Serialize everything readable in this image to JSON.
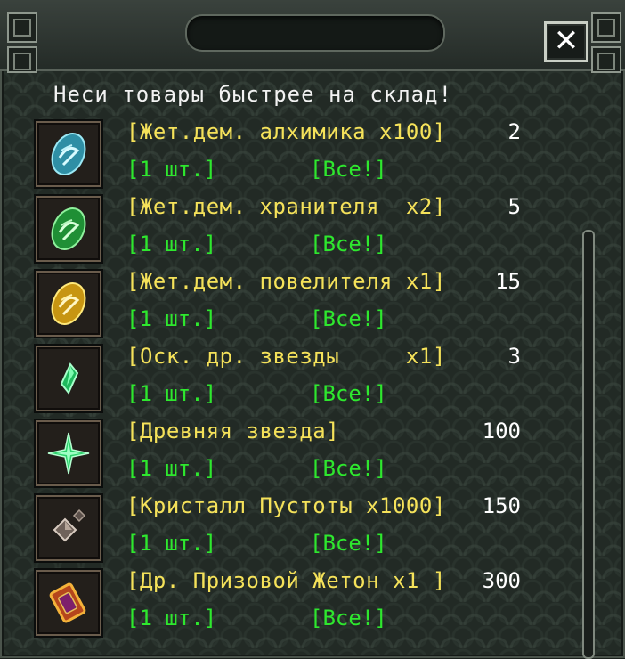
{
  "window": {
    "close_label": "✕",
    "headline": "Неси товары быстрее на склад!"
  },
  "items": [
    {
      "name": "[Жет.дем. алхимика x100]",
      "price": "2",
      "one": "[1 шт.]",
      "all": "[Все!]",
      "icon": "blue-demon-token-icon",
      "color": "#4cc6d8"
    },
    {
      "name": "[Жет.дем. хранителя  x2]",
      "price": "5",
      "one": "[1 шт.]",
      "all": "[Все!]",
      "icon": "green-demon-token-icon",
      "color": "#3fcf54"
    },
    {
      "name": "[Жет.дем. повелителя x1]",
      "price": "15",
      "one": "[1 шт.]",
      "all": "[Все!]",
      "icon": "gold-demon-token-icon",
      "color": "#f2c51a"
    },
    {
      "name": "[Оск. др. звезды     x1]",
      "price": "3",
      "one": "[1 шт.]",
      "all": "[Все!]",
      "icon": "star-shard-icon",
      "color": "#36d77a"
    },
    {
      "name": "[Древняя звезда]",
      "price": "100",
      "one": "[1 шт.]",
      "all": "[Все!]",
      "icon": "ancient-star-icon",
      "color": "#46e07a"
    },
    {
      "name": "[Кристалл Пустоты x1000]",
      "price": "150",
      "one": "[1 шт.]",
      "all": "[Все!]",
      "icon": "void-crystal-icon",
      "color": "#8c7d74"
    },
    {
      "name": "[Др. Призовой Жетон x1 ]",
      "price": "300",
      "one": "[1 шт.]",
      "all": "[Все!]",
      "icon": "prize-token-icon",
      "color": "#d88a1c"
    }
  ]
}
